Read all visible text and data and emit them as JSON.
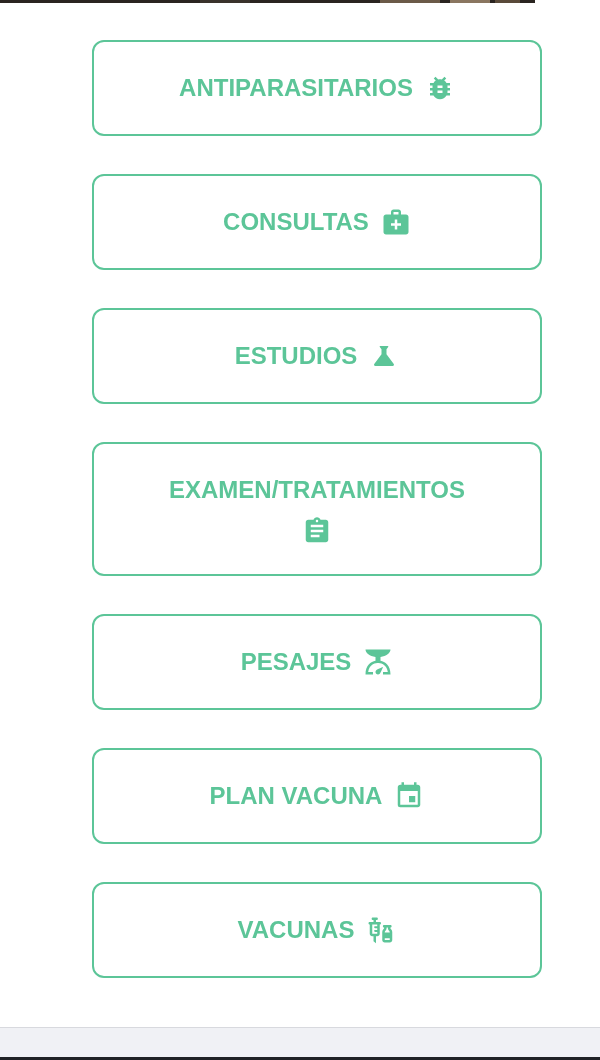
{
  "menu": [
    {
      "label": "ANTIPARASITARIOS",
      "kind": "bug"
    },
    {
      "label": "CONSULTAS",
      "kind": "medkit"
    },
    {
      "label": "ESTUDIOS",
      "kind": "flask"
    },
    {
      "label": "EXAMEN/TRATAMIENTOS",
      "kind": "clipboard"
    },
    {
      "label": "PESAJES",
      "kind": "scale"
    },
    {
      "label": "PLAN VACUNA",
      "kind": "calendar"
    },
    {
      "label": "VACUNAS",
      "kind": "vaccine"
    }
  ]
}
